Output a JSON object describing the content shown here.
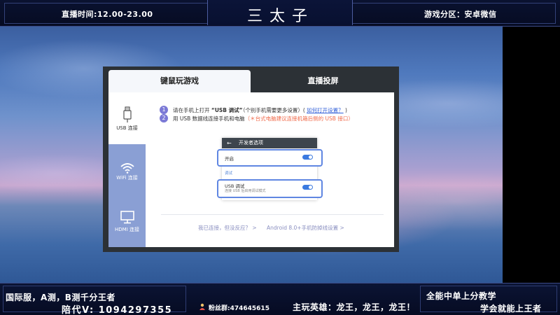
{
  "header": {
    "live_time": "直播时间:12.00-23.00",
    "title": "三太子",
    "game_zone": "游戏分区：安卓微信"
  },
  "dialog": {
    "tabs": [
      {
        "label": "键鼠玩游戏",
        "active": true
      },
      {
        "label": "直播投屏",
        "active": false
      }
    ],
    "sidebar": [
      {
        "label": "USB 连接",
        "icon": "usb-icon",
        "active": true
      },
      {
        "label": "WiFi 连接",
        "icon": "wifi-icon",
        "active": false
      },
      {
        "label": "HDMI 连接",
        "icon": "monitor-icon",
        "active": false
      }
    ],
    "steps": [
      {
        "num": "1",
        "pre": "请在手机上打开 ",
        "highlight": "“USB 调试”",
        "mid": "（个别手机需要更多设置）( ",
        "link": "如何打开设置？",
        "post": " )"
      },
      {
        "num": "2",
        "text": "用 USB 数据线连接手机和电脑",
        "warning": "（＊台式电脑建议连接机箱后侧的 USB 接口）"
      }
    ],
    "phone": {
      "back": "←",
      "header": "开发者选项",
      "option1": "开启",
      "section": "调试",
      "option2": "USB 调试",
      "option2_sub": "连接 USB 后启用调试模式"
    },
    "footer_links": [
      "我已连接，但没反应？ >",
      "Android 8.0+手机防掉线设置 >"
    ]
  },
  "bottom": {
    "server": "国际服，A测，B测千分王者",
    "contact": "陪代V: 1094297355",
    "fans_group": "粉丝群:474645615",
    "main_hero": "主玩英雄：龙王，龙王，龙王！",
    "slogan1": "全能中单上分教学",
    "slogan2": "学会就能上王者"
  },
  "colors": {
    "accent": "#7b79d6",
    "link": "#3260d8",
    "warning": "#f06a4a",
    "toggle_on": "#3b7ae0",
    "sidebar_inactive": "#8a9fd4"
  }
}
